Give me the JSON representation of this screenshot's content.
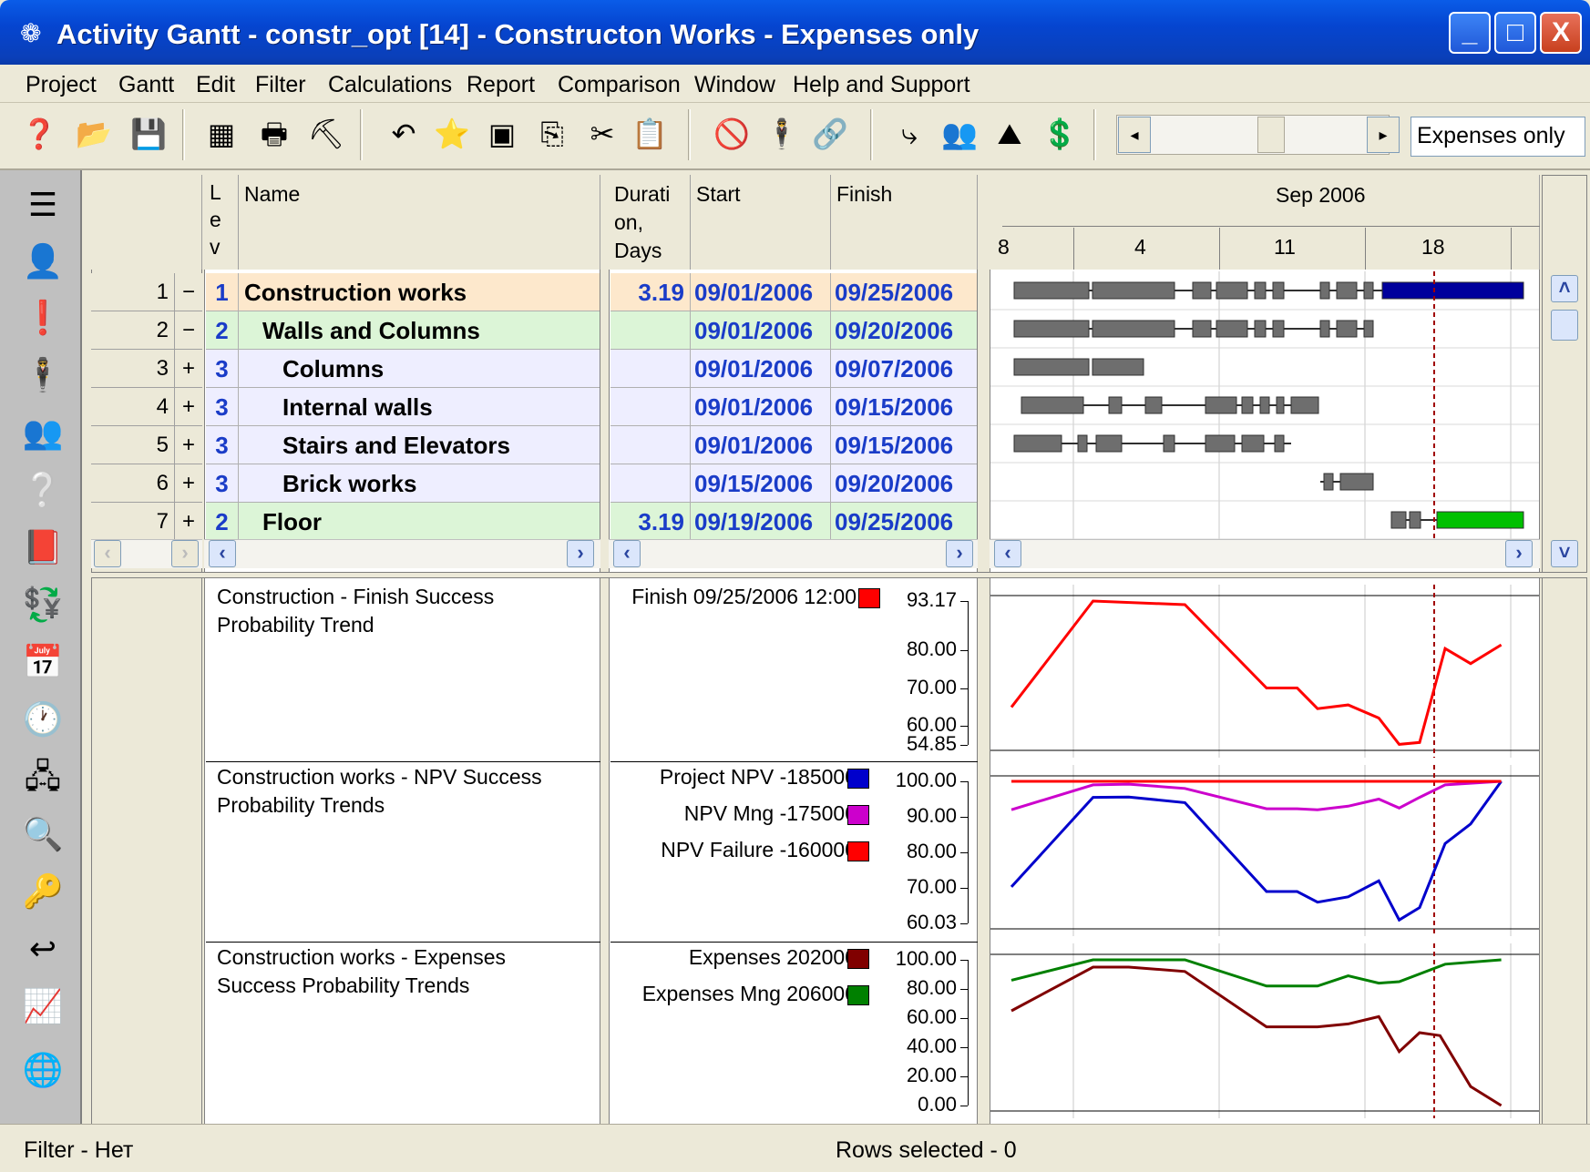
{
  "window": {
    "title": "Activity Gantt - constr_opt [14] - Constructon Works - Expenses only",
    "min_label": "_",
    "max_label": "□",
    "close_label": "X"
  },
  "menu": [
    "Project",
    "Gantt",
    "Edit",
    "Filter",
    "Calculations",
    "Report",
    "Comparison",
    "Window",
    "Help and Support"
  ],
  "toolbar": {
    "scenario_combo": "Expenses only",
    "scroll_left": "◂",
    "scroll_right": "▸"
  },
  "columns": {
    "level": "L e v",
    "name": "Name",
    "duration": "Durati on, Days",
    "start": "Start",
    "finish": "Finish"
  },
  "timeline": {
    "month": "Sep 2006",
    "days": [
      "8",
      "4",
      "11",
      "18"
    ]
  },
  "tasks": [
    {
      "no": "1",
      "toggle": "−",
      "lev": "1",
      "name": "Construction works",
      "duration": "3.19",
      "start": "09/01/2006",
      "finish": "09/25/2006"
    },
    {
      "no": "2",
      "toggle": "−",
      "lev": "2",
      "name": "Walls and Columns",
      "duration": "",
      "start": "09/01/2006",
      "finish": "09/20/2006"
    },
    {
      "no": "3",
      "toggle": "+",
      "lev": "3",
      "name": "Columns",
      "duration": "",
      "start": "09/01/2006",
      "finish": "09/07/2006"
    },
    {
      "no": "4",
      "toggle": "+",
      "lev": "3",
      "name": "Internal walls",
      "duration": "",
      "start": "09/01/2006",
      "finish": "09/15/2006"
    },
    {
      "no": "5",
      "toggle": "+",
      "lev": "3",
      "name": "Stairs and Elevators",
      "duration": "",
      "start": "09/01/2006",
      "finish": "09/15/2006"
    },
    {
      "no": "6",
      "toggle": "+",
      "lev": "3",
      "name": "Brick works",
      "duration": "",
      "start": "09/15/2006",
      "finish": "09/20/2006"
    },
    {
      "no": "7",
      "toggle": "+",
      "lev": "2",
      "name": "Floor",
      "duration": "3.19",
      "start": "09/19/2006",
      "finish": "09/25/2006"
    }
  ],
  "charts_text": {
    "c1_title": "Construction - Finish Success Probability Trend",
    "c2_title": "Construction works - NPV Success Probability Trends",
    "c3_title": "Construction works - Expenses Success Probability Trends"
  },
  "chart_data": [
    {
      "type": "line",
      "title": "Construction - Finish Success Probability Trend",
      "ylim": [
        54.85,
        93.17
      ],
      "yticks": [
        "93.17",
        "80.00",
        "70.00",
        "60.00",
        "54.85"
      ],
      "series": [
        {
          "name": "Finish 09/25/2006  12:00",
          "color": "#ff0000",
          "points": [
            [
              0,
              64.9
            ],
            [
              1.6,
              93.17
            ],
            [
              3.4,
              92.2
            ],
            [
              5.0,
              70.0
            ],
            [
              5.6,
              70.0
            ],
            [
              6.0,
              64.5
            ],
            [
              6.6,
              65.5
            ],
            [
              7.2,
              62.0
            ],
            [
              7.6,
              55.0
            ],
            [
              8.0,
              55.5
            ],
            [
              8.5,
              80.5
            ],
            [
              9.0,
              76.5
            ],
            [
              9.6,
              81.5
            ]
          ]
        }
      ]
    },
    {
      "type": "line",
      "title": "Construction works - NPV Success Probability Trends",
      "ylim": [
        60.03,
        100
      ],
      "yticks": [
        "100.00",
        "90.00",
        "80.00",
        "70.00",
        "60.03"
      ],
      "series": [
        {
          "name": "Project NPV -185000",
          "color": "#0000cc",
          "points": [
            [
              0,
              70.3
            ],
            [
              1.6,
              95.5
            ],
            [
              2.3,
              95.6
            ],
            [
              3.4,
              94.0
            ],
            [
              5.0,
              69.0
            ],
            [
              5.6,
              69.0
            ],
            [
              6.0,
              66.0
            ],
            [
              6.6,
              67.5
            ],
            [
              7.2,
              72.0
            ],
            [
              7.6,
              61.0
            ],
            [
              8.0,
              64.5
            ],
            [
              8.5,
              82.5
            ],
            [
              9.0,
              88.0
            ],
            [
              9.6,
              100.0
            ]
          ]
        },
        {
          "name": "NPV Mng -175000",
          "color": "#cc00cc",
          "points": [
            [
              0,
              92.0
            ],
            [
              1.6,
              99.0
            ],
            [
              2.3,
              99.2
            ],
            [
              3.4,
              98.0
            ],
            [
              5.0,
              92.3
            ],
            [
              5.6,
              92.3
            ],
            [
              6.0,
              92.0
            ],
            [
              6.6,
              93.0
            ],
            [
              7.2,
              95.0
            ],
            [
              7.6,
              92.5
            ],
            [
              8.0,
              95.5
            ],
            [
              8.5,
              99.0
            ],
            [
              9.6,
              100.0
            ]
          ]
        },
        {
          "name": "NPV Failure -160000",
          "color": "#ff0000",
          "points": [
            [
              0,
              100.0
            ],
            [
              9.6,
              100.0
            ]
          ]
        }
      ]
    },
    {
      "type": "line",
      "title": "Construction works - Expenses Success Probability Trends",
      "ylim": [
        0,
        100
      ],
      "yticks": [
        "100.00",
        "80.00",
        "60.00",
        "40.00",
        "20.00",
        "0.00"
      ],
      "series": [
        {
          "name": "Expenses 202000",
          "color": "#800000",
          "points": [
            [
              0,
              65.0
            ],
            [
              1.6,
              95.0
            ],
            [
              2.3,
              95.0
            ],
            [
              3.4,
              92.0
            ],
            [
              5.0,
              54.0
            ],
            [
              5.6,
              54.0
            ],
            [
              6.0,
              54.0
            ],
            [
              6.6,
              56.0
            ],
            [
              7.2,
              61.0
            ],
            [
              7.6,
              37.0
            ],
            [
              8.0,
              50.0
            ],
            [
              8.4,
              48.0
            ],
            [
              9.0,
              13.0
            ],
            [
              9.6,
              0.0
            ]
          ]
        },
        {
          "name": "Expenses Mng 206000",
          "color": "#008000",
          "points": [
            [
              0,
              86.0
            ],
            [
              1.6,
              100.0
            ],
            [
              2.3,
              100.0
            ],
            [
              3.4,
              100.0
            ],
            [
              5.0,
              82.0
            ],
            [
              5.6,
              82.0
            ],
            [
              6.0,
              82.0
            ],
            [
              6.6,
              89.0
            ],
            [
              7.2,
              84.0
            ],
            [
              7.6,
              85.0
            ],
            [
              8.5,
              97.0
            ],
            [
              9.6,
              100.0
            ]
          ]
        }
      ]
    }
  ],
  "status": {
    "filter": "Filter -  Нет",
    "rows_selected": "Rows selected -  0"
  }
}
